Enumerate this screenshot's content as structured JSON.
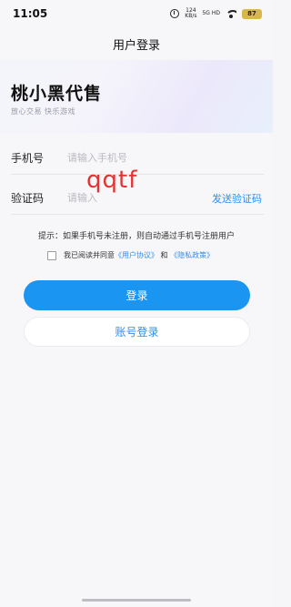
{
  "status_bar": {
    "time": "11:05",
    "net_speed": "124",
    "net_unit": "KB/s",
    "network_label": "5G HD",
    "battery": "87"
  },
  "header": {
    "title": "用户登录"
  },
  "hero": {
    "app_title": "桃小黑代售",
    "subtitle": "放心交易 快乐游戏"
  },
  "form": {
    "phone": {
      "label": "手机号",
      "placeholder": "请输入手机号",
      "value": ""
    },
    "code": {
      "label": "验证码",
      "placeholder": "请输入",
      "value": "",
      "send_label": "发送验证码"
    },
    "watermark": "qqtf"
  },
  "hint": "提示：如果手机号未注册，则自动通过手机号注册用户",
  "agreement": {
    "prefix": "我已阅读并同意",
    "user_agreement": "《用户协议》",
    "and": "和",
    "privacy_policy": "《隐私政策》",
    "checked": false
  },
  "buttons": {
    "login": "登录",
    "account_login": "账号登录"
  },
  "colors": {
    "accent": "#1a95f2",
    "link": "#2f8ef0",
    "watermark": "#e33232"
  }
}
